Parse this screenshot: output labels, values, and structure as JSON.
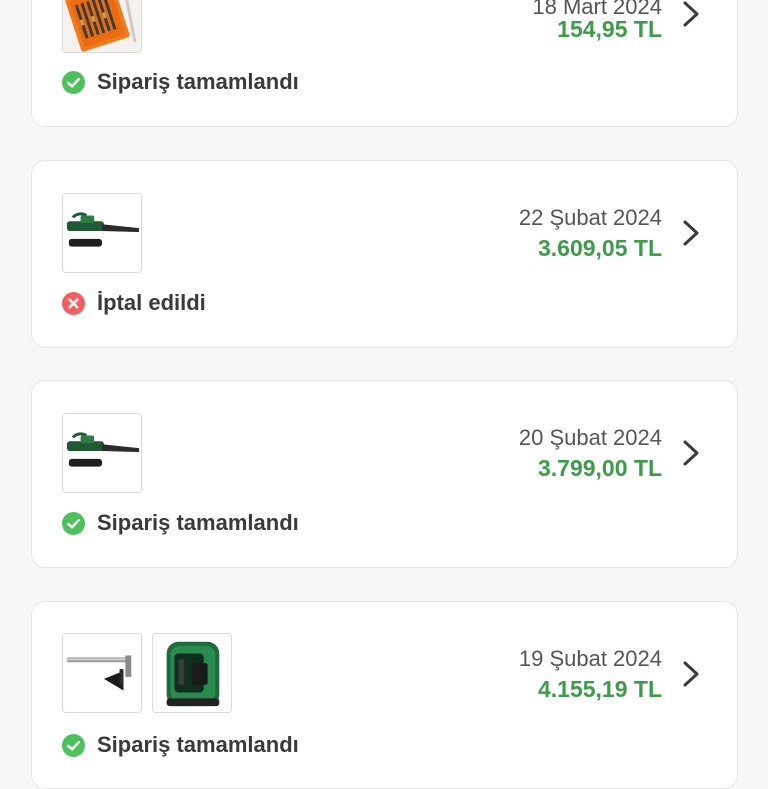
{
  "orders": [
    {
      "date": "18 Mart 2024",
      "price": "154,95 TL",
      "status": "Sipariş tamamlandı",
      "status_type": "completed",
      "thumbnails": [
        "drill-bit-set"
      ]
    },
    {
      "date": "22 Şubat 2024",
      "price": "3.609,05 TL",
      "status": "İptal edildi",
      "status_type": "cancelled",
      "thumbnails": [
        "chainsaw"
      ]
    },
    {
      "date": "20 Şubat 2024",
      "price": "3.799,00 TL",
      "status": "Sipariş tamamlandı",
      "status_type": "completed",
      "thumbnails": [
        "chainsaw"
      ]
    },
    {
      "date": "19 Şubat 2024",
      "price": "4.155,19 TL",
      "status": "Sipariş tamamlandı",
      "status_type": "completed",
      "thumbnails": [
        "laser-level-mount",
        "cross-line-laser-level"
      ]
    }
  ],
  "colors": {
    "price": "#3d9b4a",
    "completed": "#4cc15c",
    "cancelled": "#ef5f5f",
    "chevron": "#3a3a3a"
  },
  "icons": {
    "completed": "check-circle-icon",
    "cancelled": "x-circle-icon",
    "navigate": "chevron-right-icon"
  }
}
